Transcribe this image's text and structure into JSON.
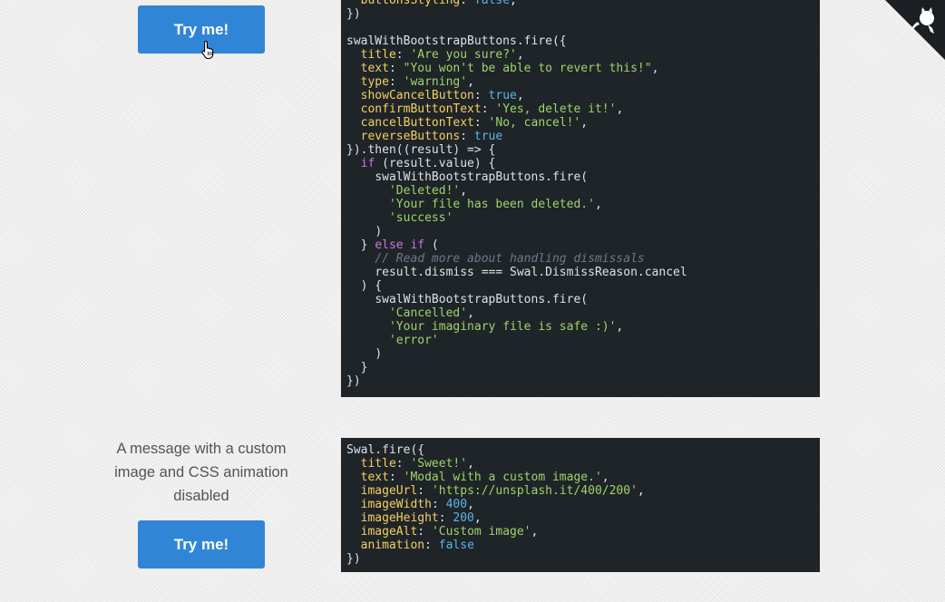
{
  "section1": {
    "try_label": "Try me!",
    "code": {
      "l01": {
        "k": "buttonsStyling",
        "v": "false"
      },
      "l02": "})",
      "l03": "swalWithBootstrapButtons.fire({",
      "l04": {
        "k": "title",
        "v": "'Are you sure?'"
      },
      "l05": {
        "k": "text",
        "v": "\"You won't be able to revert this!\""
      },
      "l06": {
        "k": "type",
        "v": "'warning'"
      },
      "l07": {
        "k": "showCancelButton",
        "v": "true"
      },
      "l08": {
        "k": "confirmButtonText",
        "v": "'Yes, delete it!'"
      },
      "l09": {
        "k": "cancelButtonText",
        "v": "'No, cancel!'"
      },
      "l10": {
        "k": "reverseButtons",
        "v": "true"
      },
      "l11": "}).then((result) => {",
      "l12": {
        "kw": "if",
        "rest": " (result.value) {"
      },
      "l13": "swalWithBootstrapButtons.fire(",
      "l14": "'Deleted!'",
      "l15": "'Your file has been deleted.'",
      "l16": "'success'",
      "l17": ")",
      "l18": {
        "pre": "} ",
        "kw": "else if",
        "rest": " ("
      },
      "l19": "// Read more about handling dismissals",
      "l20": "result.dismiss === Swal.DismissReason.cancel",
      "l21": ") {",
      "l22": "swalWithBootstrapButtons.fire(",
      "l23": "'Cancelled'",
      "l24": "'Your imaginary file is safe :)'",
      "l25": "'error'",
      "l26": ")",
      "l27": "}",
      "l28": "})"
    }
  },
  "section2": {
    "description": "A message with a custom image and CSS animation disabled",
    "try_label": "Try me!",
    "code": {
      "l01": "Swal.fire({",
      "l02": {
        "k": "title",
        "v": "'Sweet!'"
      },
      "l03": {
        "k": "text",
        "v": "'Modal with a custom image.'"
      },
      "l04": {
        "k": "imageUrl",
        "v": "'https://unsplash.it/400/200'"
      },
      "l05": {
        "k": "imageWidth",
        "v": "400"
      },
      "l06": {
        "k": "imageHeight",
        "v": "200"
      },
      "l07": {
        "k": "imageAlt",
        "v": "'Custom image'"
      },
      "l08": {
        "k": "animation",
        "v": "false"
      },
      "l09": "})"
    }
  },
  "icons": {
    "corner": "github-octocat-icon",
    "cursor": "hand-pointer-icon"
  },
  "colors": {
    "button": "#3085d6",
    "code_bg": "#1f2428",
    "key": "#f3cf62",
    "string": "#9ed36a",
    "literal": "#58b6e8",
    "keyword": "#c678dd",
    "comment": "#6a7a8c"
  }
}
